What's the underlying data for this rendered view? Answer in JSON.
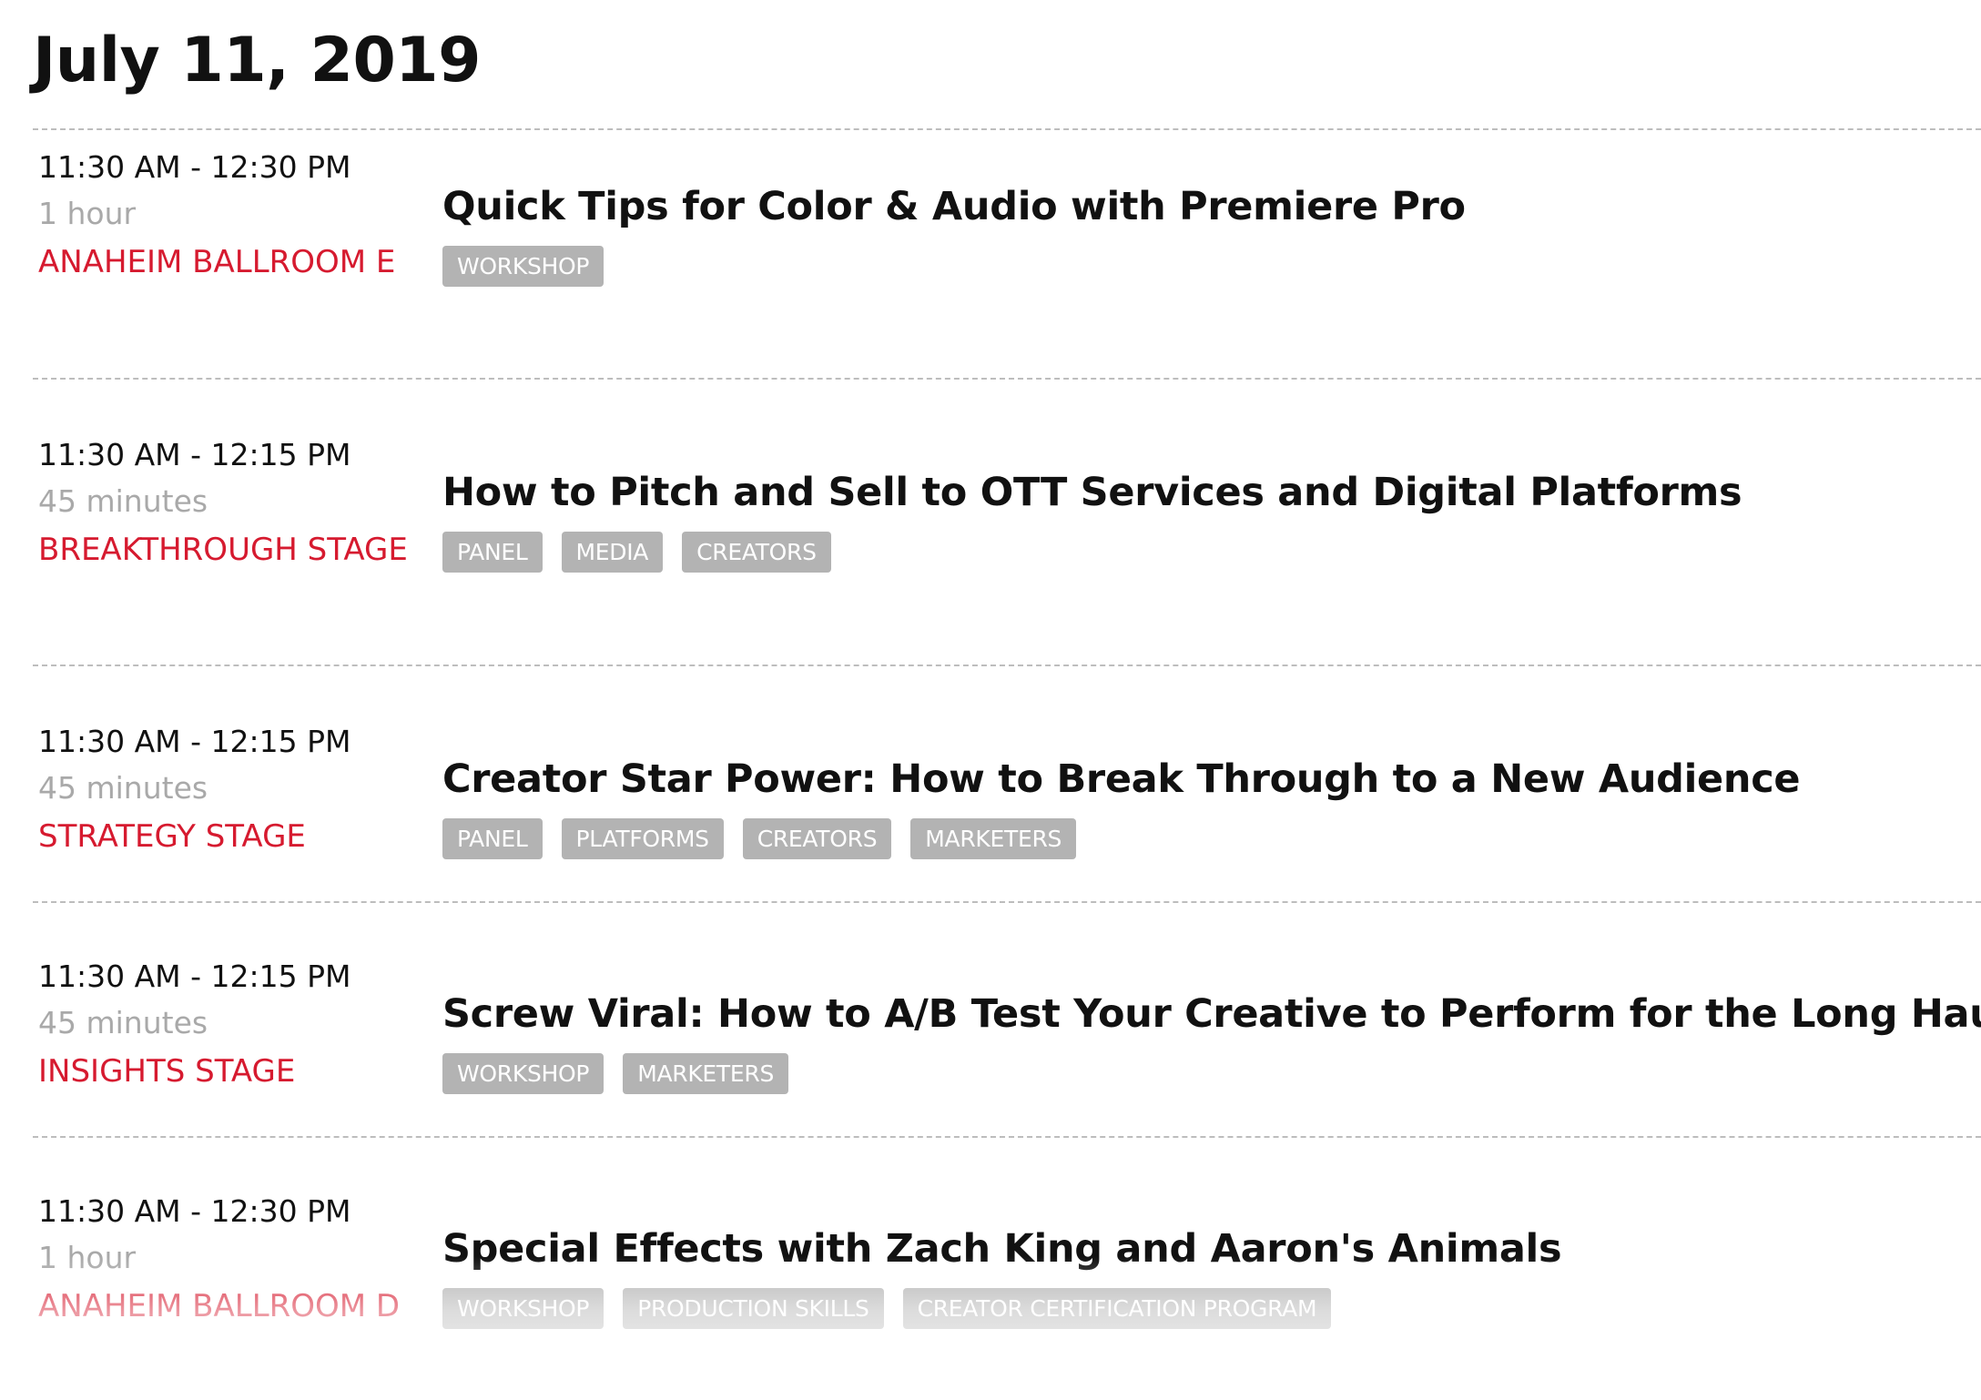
{
  "date_heading": "July 11, 2019",
  "sessions": [
    {
      "time": "11:30 AM - 12:30 PM",
      "duration": "1 hour",
      "location": "ANAHEIM BALLROOM E",
      "title": "Quick Tips for Color & Audio with Premiere Pro",
      "tags": [
        "WORKSHOP"
      ]
    },
    {
      "time": "11:30 AM - 12:15 PM",
      "duration": "45 minutes",
      "location": "BREAKTHROUGH STAGE",
      "title": "How to Pitch and Sell to OTT Services and Digital Platforms",
      "tags": [
        "PANEL",
        "MEDIA",
        "CREATORS"
      ]
    },
    {
      "time": "11:30 AM - 12:15 PM",
      "duration": "45 minutes",
      "location": "STRATEGY STAGE",
      "title": "Creator Star Power: How to Break Through to a New Audience",
      "tags": [
        "PANEL",
        "PLATFORMS",
        "CREATORS",
        "MARKETERS"
      ]
    },
    {
      "time": "11:30 AM - 12:15 PM",
      "duration": "45 minutes",
      "location": "INSIGHTS STAGE",
      "title": "Screw Viral: How to A/B Test Your Creative to Perform for the Long Haul",
      "tags": [
        "WORKSHOP",
        "MARKETERS"
      ]
    },
    {
      "time": "11:30 AM - 12:30 PM",
      "duration": "1 hour",
      "location": "ANAHEIM BALLROOM D",
      "title": "Special Effects with Zach King and Aaron's Animals",
      "tags": [
        "WORKSHOP",
        "PRODUCTION SKILLS",
        "CREATOR CERTIFICATION PROGRAM"
      ]
    }
  ],
  "colors": {
    "location_red": "#d61a2f",
    "duration_gray": "#a9a9a9",
    "tag_bg": "#b3b3b3",
    "divider": "#bdbdbd"
  }
}
